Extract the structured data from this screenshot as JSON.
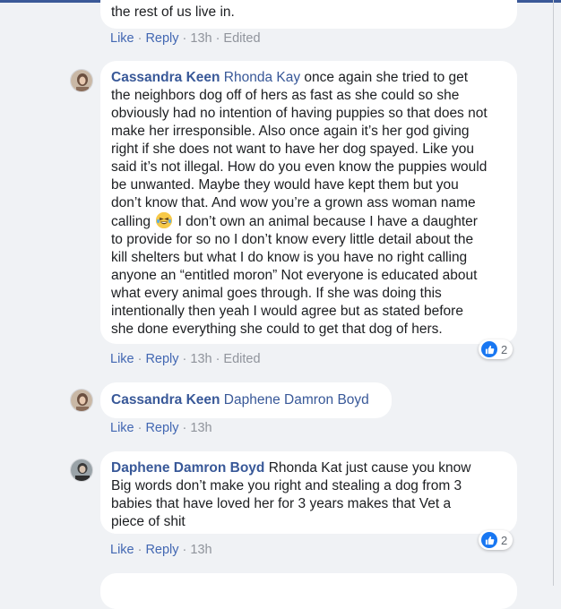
{
  "comments": [
    {
      "text_tail": "the rest of us live in.",
      "actions": {
        "like": "Like",
        "reply": "Reply",
        "time": "13h",
        "edited": "Edited"
      }
    },
    {
      "author": "Cassandra Keen",
      "tag": "Rhonda Kay",
      "lines": [
        " once again she tried to get",
        "the neighbors dog off of hers as fast as she could so she",
        "obviously had no intention of having puppies so that does not",
        "make her irresponsible. Also once again it’s her god giving",
        "right if she does not want to have her dog spayed. Like you",
        "said it’s not illegal. How do you even know the puppies would",
        "be unwanted. Maybe they would have kept them but you",
        "don’t know that. And wow you’re a grown ass woman name",
        "calling",
        " I don’t own an animal because I have a daughter",
        "to provide for so no I don’t know every little detail about the",
        "kill shelters but what I do know is you have no right calling",
        "anyone an “entitled moron” Not everyone is educated about",
        "what every animal goes through. If she was doing this",
        "intentionally then yeah I would agree but as stated before",
        "she done everything she could to get that dog of hers."
      ],
      "emoji": "grinning-squinting-face",
      "reaction": {
        "type": "like",
        "count": "2"
      },
      "actions": {
        "like": "Like",
        "reply": "Reply",
        "time": "13h",
        "edited": "Edited"
      }
    },
    {
      "author": "Cassandra Keen",
      "tag": "Daphene Damron Boyd",
      "actions": {
        "like": "Like",
        "reply": "Reply",
        "time": "13h"
      }
    },
    {
      "author": "Daphene Damron Boyd",
      "lines": [
        " Rhonda Kat just cause you know",
        "Big words don’t make you right and stealing a dog from 3",
        "babies that have loved her for 3 years makes that Vet a",
        "piece of shit"
      ],
      "reaction": {
        "type": "like",
        "count": "2"
      },
      "actions": {
        "like": "Like",
        "reply": "Reply",
        "time": "13h"
      }
    }
  ],
  "colors": {
    "link": "#385898",
    "action": "#4267b2",
    "muted": "#90949c",
    "like": "#1877f2"
  }
}
